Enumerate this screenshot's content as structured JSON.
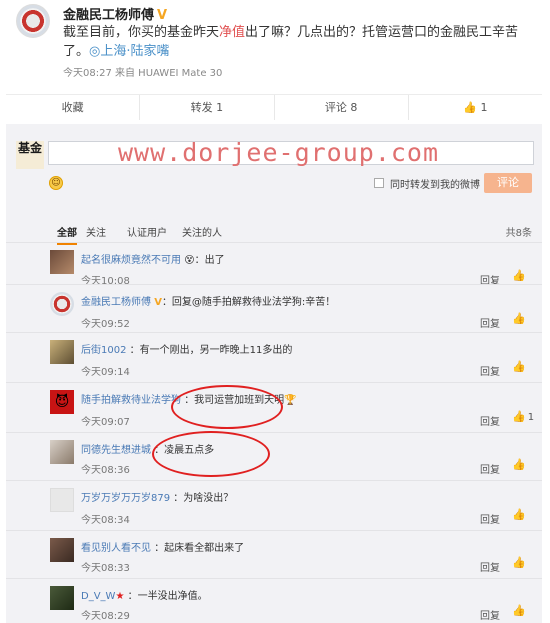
{
  "post": {
    "author": "金融民工杨师傅",
    "text_before": "截至目前，你买的基金昨天",
    "text_highlight": "净值",
    "text_after": "出了嘛？几点出的？托管运营口的金融民工辛苦了。",
    "location": "◎上海·陆家嘴",
    "meta": "今天08:27  来自 HUAWEI Mate 30"
  },
  "actions": {
    "favorite": "收藏",
    "repost": "转发 1",
    "comment": "评论 8",
    "like": "1"
  },
  "composer": {
    "self_avatar": "基金",
    "watermark": "www.dorjee-group.com",
    "repost_label": "同时转发到我的微博",
    "submit": "评论"
  },
  "tabs": {
    "all": "全部",
    "follow": "关注",
    "verified": "认证用户",
    "followed_by": "关注的人",
    "count": "共8条"
  },
  "comments": [
    {
      "name": "起名很麻烦竟然不可用",
      "emoji": "😵",
      "text": "：出了",
      "time": "今天10:08",
      "reply": "回复",
      "likes": ""
    },
    {
      "name": "金融民工杨师傅",
      "badge": "V",
      "text": "：回复@随手拍解救待业法学狗:辛苦！",
      "time": "今天09:52",
      "reply": "回复",
      "likes": ""
    },
    {
      "name": "后街1002",
      "text": "：有一个刚出，另一昨晚上11多出的",
      "time": "今天09:14",
      "reply": "回复",
      "likes": ""
    },
    {
      "name": "随手拍解救待业法学狗",
      "text": "：我司运营加班到天明",
      "emoji": "🏆",
      "time": "今天09:07",
      "reply": "回复",
      "likes": "1"
    },
    {
      "name": "同德先生想进城",
      "text": "：凌晨五点多",
      "time": "今天08:36",
      "reply": "回复",
      "likes": ""
    },
    {
      "name": "万岁万岁万万岁879",
      "text": "：为啥没出？",
      "time": "今天08:34",
      "reply": "回复",
      "likes": ""
    },
    {
      "name": "看见别人看不见",
      "text": "：起床看全都出来了",
      "time": "今天08:33",
      "reply": "回复",
      "likes": ""
    },
    {
      "name": "D_V_W",
      "badge_star": "★",
      "text": "：一半没出净值。",
      "time": "今天08:29",
      "reply": "回复",
      "likes": ""
    }
  ],
  "colors": {
    "accent": "#f08200",
    "link": "#4a7ab5",
    "annotation": "#e02020",
    "watermark": "#e07070",
    "submit": "#f6b48e"
  }
}
